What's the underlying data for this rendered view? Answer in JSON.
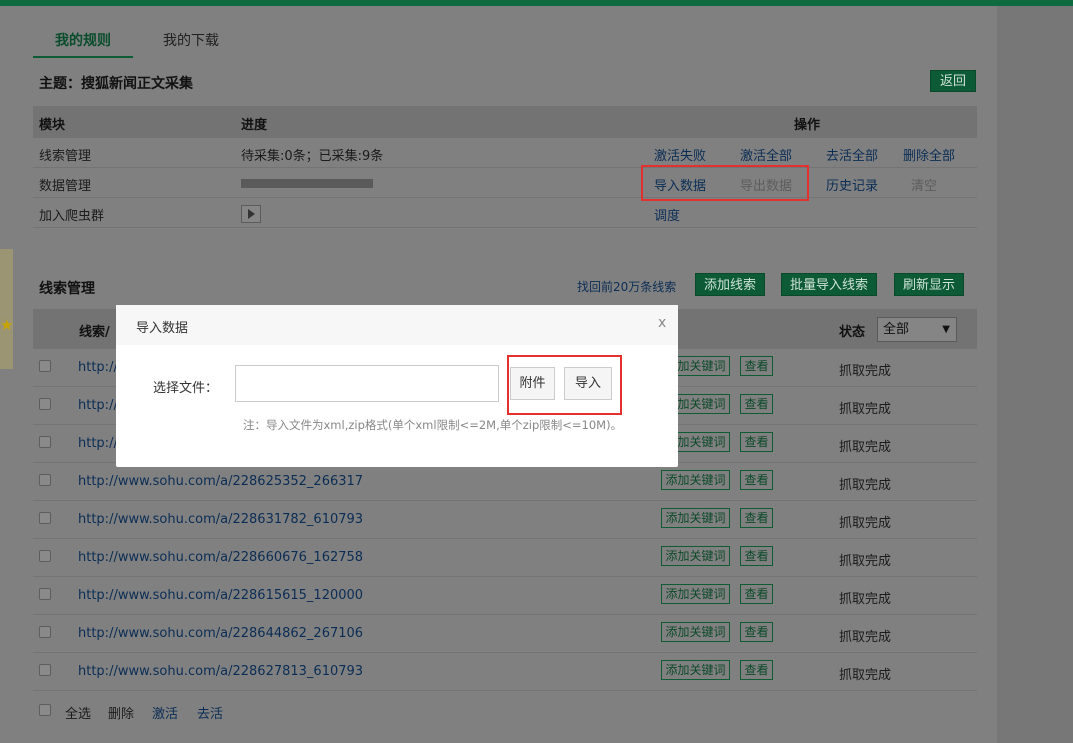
{
  "tabs": [
    "我的规则",
    "我的下载"
  ],
  "subject": "主题：搜狐新闻正文采集",
  "back_label": "返回",
  "rules": {
    "headers": {
      "module": "模块",
      "progress": "进度",
      "actions": "操作"
    },
    "rows": [
      {
        "label": "线索管理",
        "progress_text": "待采集:0条；已采集:9条",
        "actions": [
          "激活失败",
          "激活全部",
          "去活全部",
          "删除全部"
        ]
      },
      {
        "label": "数据管理",
        "actions": [
          "导入数据",
          "导出数据",
          "历史记录",
          "清空"
        ]
      },
      {
        "label": "加入爬虫群",
        "actions": [
          "调度"
        ]
      }
    ]
  },
  "clues": {
    "title": "线索管理",
    "recover_link": "找回前20万条线索",
    "buttons": [
      "添加线索",
      "批量导入线索",
      "刷新显示"
    ],
    "header_clue": "线索/",
    "header_status": "状态",
    "status_filter": "全部",
    "kw_label": "添加关键词",
    "view_label": "查看",
    "rows": [
      {
        "url": "http://",
        "status": "抓取完成"
      },
      {
        "url": "http://",
        "status": "抓取完成"
      },
      {
        "url": "http://",
        "status": "抓取完成"
      },
      {
        "url": "http://www.sohu.com/a/228625352_266317",
        "status": "抓取完成"
      },
      {
        "url": "http://www.sohu.com/a/228631782_610793",
        "status": "抓取完成"
      },
      {
        "url": "http://www.sohu.com/a/228660676_162758",
        "status": "抓取完成"
      },
      {
        "url": "http://www.sohu.com/a/228615615_120000",
        "status": "抓取完成"
      },
      {
        "url": "http://www.sohu.com/a/228644862_267106",
        "status": "抓取完成"
      },
      {
        "url": "http://www.sohu.com/a/228627813_610793",
        "status": "抓取完成"
      }
    ],
    "footer": [
      "全选",
      "删除",
      "激活",
      "去活"
    ]
  },
  "modal": {
    "title": "导入数据",
    "close": "x",
    "field_label": "选择文件：",
    "attach_label": "附件",
    "import_label": "导入",
    "note": "注：导入文件为xml,zip格式(单个xml限制<=2M,单个zip限制<=10M)。"
  },
  "colors": {
    "accent": "#0d5a36",
    "highlight": "#e53030",
    "link": "#0b2d55"
  }
}
